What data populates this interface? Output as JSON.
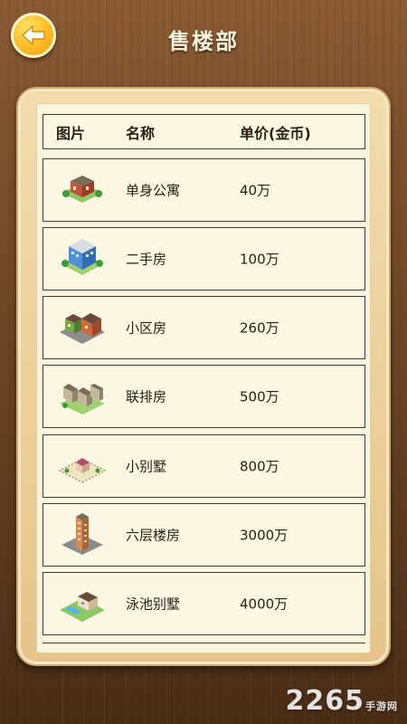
{
  "header": {
    "title": "售楼部"
  },
  "table": {
    "columns": {
      "image": "图片",
      "name": "名称",
      "price": "单价(金币)"
    },
    "rows": [
      {
        "name": "单身公寓",
        "price": "40万",
        "icon": "single-apartment-icon"
      },
      {
        "name": "二手房",
        "price": "100万",
        "icon": "second-hand-house-icon"
      },
      {
        "name": "小区房",
        "price": "260万",
        "icon": "community-house-icon"
      },
      {
        "name": "联排房",
        "price": "500万",
        "icon": "townhouse-icon"
      },
      {
        "name": "小别墅",
        "price": "800万",
        "icon": "small-villa-icon"
      },
      {
        "name": "六层楼房",
        "price": "3000万",
        "icon": "six-story-building-icon"
      },
      {
        "name": "泳池别墅",
        "price": "4000万",
        "icon": "pool-villa-icon"
      }
    ]
  },
  "watermark": {
    "brand": "2265",
    "suffix": "手游网"
  },
  "colors": {
    "background": "#6b4424",
    "panel": "#f2dcae",
    "back_button": "#ffc22a"
  }
}
